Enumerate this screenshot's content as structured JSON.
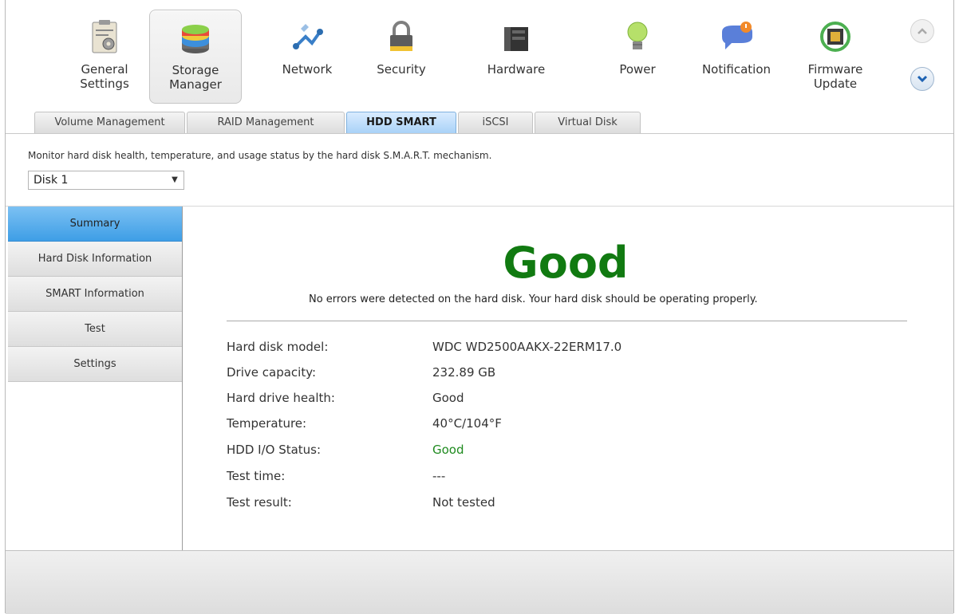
{
  "toolbar": {
    "items": [
      {
        "label": "General\nSettings",
        "icon": "clipboard-gear-icon"
      },
      {
        "label": "Storage\nManager",
        "icon": "storage-disks-icon"
      },
      {
        "label": "Network",
        "icon": "network-icon"
      },
      {
        "label": "Security",
        "icon": "padlock-icon"
      },
      {
        "label": "Hardware",
        "icon": "hardware-icon"
      },
      {
        "label": "Power",
        "icon": "bulb-icon"
      },
      {
        "label": "Notification",
        "icon": "chat-bubble-alert-icon"
      },
      {
        "label": "Firmware\nUpdate",
        "icon": "chip-refresh-icon"
      }
    ],
    "active_index": 1,
    "scroll_up_icon": "chevron-up-icon",
    "scroll_down_icon": "chevron-down-icon"
  },
  "tabs": [
    {
      "label": "Volume Management"
    },
    {
      "label": "RAID Management"
    },
    {
      "label": "HDD SMART"
    },
    {
      "label": "iSCSI"
    },
    {
      "label": "Virtual Disk"
    }
  ],
  "active_tab": "HDD SMART",
  "description": "Monitor hard disk health, temperature, and usage status by the hard disk S.M.A.R.T. mechanism.",
  "disk_select": {
    "value": "Disk 1"
  },
  "nav": {
    "items": [
      {
        "label": "Summary"
      },
      {
        "label": "Hard Disk Information"
      },
      {
        "label": "SMART Information"
      },
      {
        "label": "Test"
      },
      {
        "label": "Settings"
      }
    ],
    "active": "Summary"
  },
  "summary": {
    "status": "Good",
    "message": "No errors were detected on the hard disk. Your hard disk should be operating properly.",
    "rows": [
      {
        "label": "Hard disk model:",
        "value": "WDC WD2500AAKX-22ERM17.0"
      },
      {
        "label": "Drive capacity:",
        "value": "232.89 GB"
      },
      {
        "label": "Hard drive health:",
        "value": "Good"
      },
      {
        "label": "Temperature:",
        "value": "40°C/104°F"
      },
      {
        "label": "HDD I/O Status:",
        "value": "Good"
      },
      {
        "label": "Test time:",
        "value": "---"
      },
      {
        "label": "Test result:",
        "value": "Not tested"
      }
    ]
  },
  "colors": {
    "status_good": "#117a11",
    "active_tab": "#a9d2f7",
    "active_nav": "#3e9ee6"
  }
}
